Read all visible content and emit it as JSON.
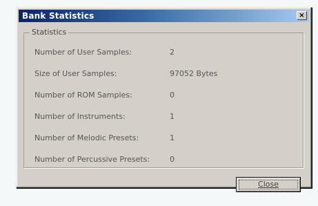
{
  "window": {
    "title": "Bank Statistics",
    "close_glyph": "×"
  },
  "group": {
    "label": "Statistics"
  },
  "stats": [
    {
      "label": "Number of User Samples:",
      "value": "2"
    },
    {
      "label": "Size of User Samples:",
      "value": "97052  Bytes"
    },
    {
      "label": "Number of ROM Samples:",
      "value": "0"
    },
    {
      "label": "Number of Instruments:",
      "value": "1"
    },
    {
      "label": "Number of Melodic Presets:",
      "value": "1"
    },
    {
      "label": "Number of Percussive Presets:",
      "value": "0"
    }
  ],
  "buttons": {
    "close_label": "Close"
  },
  "colors": {
    "titlebar_start": "#0a246a",
    "titlebar_end": "#a6caf0",
    "dialog_face": "#d4d0c8"
  }
}
